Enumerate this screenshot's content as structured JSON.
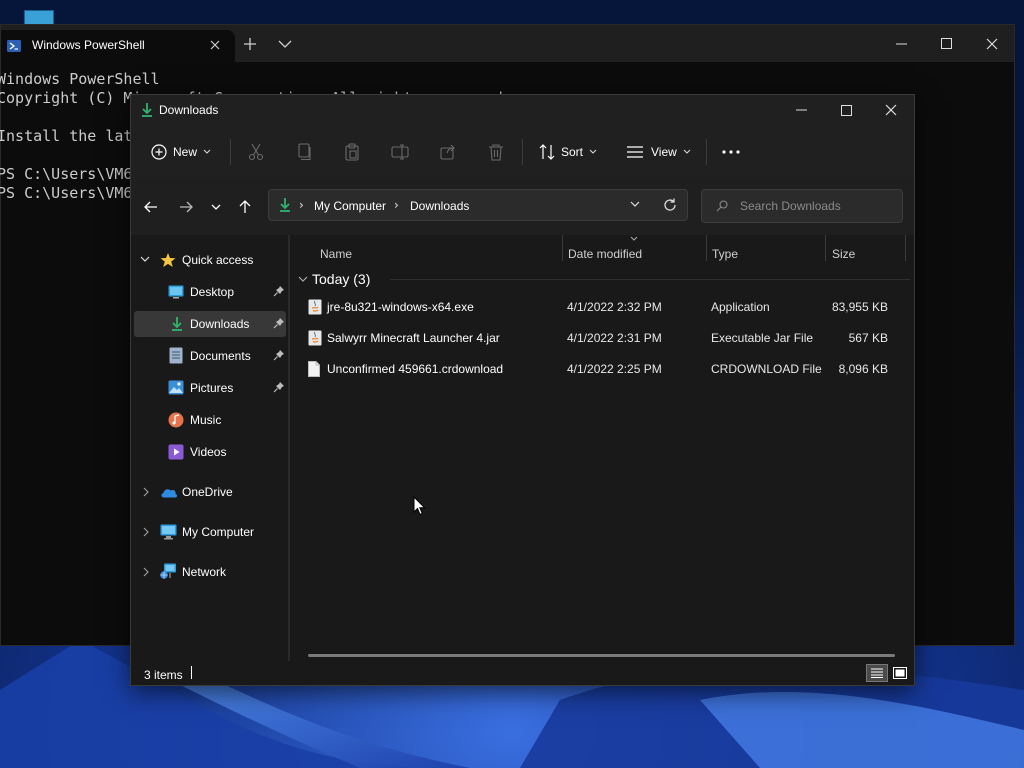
{
  "terminal": {
    "tab_title": "Windows PowerShell",
    "lines": [
      "Windows PowerShell",
      "Copyright (C) Microsoft Corporation. All rights reserved.",
      "",
      "Install the lat",
      "",
      "PS C:\\Users\\VM6",
      "PS C:\\Users\\VM6"
    ]
  },
  "explorer": {
    "title": "Downloads",
    "toolbar": {
      "new_label": "New",
      "sort_label": "Sort",
      "view_label": "View",
      "icons": [
        "cut-icon",
        "copy-icon",
        "paste-icon",
        "rename-icon",
        "share-icon",
        "delete-icon",
        "more-icon"
      ]
    },
    "address": {
      "crumbs": [
        "My Computer",
        "Downloads"
      ],
      "separator": "›"
    },
    "search": {
      "placeholder": "Search Downloads"
    },
    "sidebar": {
      "quick_access": "Quick access",
      "items": [
        {
          "label": "Desktop",
          "icon": "desktop-icon",
          "pinned": true
        },
        {
          "label": "Downloads",
          "icon": "downloads-icon",
          "pinned": true,
          "selected": true
        },
        {
          "label": "Documents",
          "icon": "documents-icon",
          "pinned": true
        },
        {
          "label": "Pictures",
          "icon": "pictures-icon",
          "pinned": true
        },
        {
          "label": "Music",
          "icon": "music-icon",
          "pinned": false
        },
        {
          "label": "Videos",
          "icon": "videos-icon",
          "pinned": false
        }
      ],
      "roots": [
        {
          "label": "OneDrive",
          "icon": "onedrive-icon"
        },
        {
          "label": "My Computer",
          "icon": "computer-icon"
        },
        {
          "label": "Network",
          "icon": "network-icon"
        }
      ]
    },
    "columns": {
      "name": "Name",
      "date": "Date modified",
      "type": "Type",
      "size": "Size"
    },
    "group": {
      "title": "Today (3)"
    },
    "files": [
      {
        "name": "jre-8u321-windows-x64.exe",
        "date": "4/1/2022 2:32 PM",
        "type": "Application",
        "size": "83,955 KB",
        "icon": "java-installer-icon"
      },
      {
        "name": "Salwyrr Minecraft Launcher 4.jar",
        "date": "4/1/2022 2:31 PM",
        "type": "Executable Jar File",
        "size": "567 KB",
        "icon": "jar-file-icon"
      },
      {
        "name": "Unconfirmed 459661.crdownload",
        "date": "4/1/2022 2:25 PM",
        "type": "CRDOWNLOAD File",
        "size": "8,096 KB",
        "icon": "blank-file-icon"
      }
    ],
    "status": {
      "count": "3 items"
    }
  },
  "colors": {
    "accent_green": "#2fb46e",
    "window_bg": "#191919",
    "titlebar_bg": "#202020",
    "selected_bg": "#383838",
    "terminal_bg": "#0c0c0c",
    "terminal_text": "#cccccc"
  }
}
